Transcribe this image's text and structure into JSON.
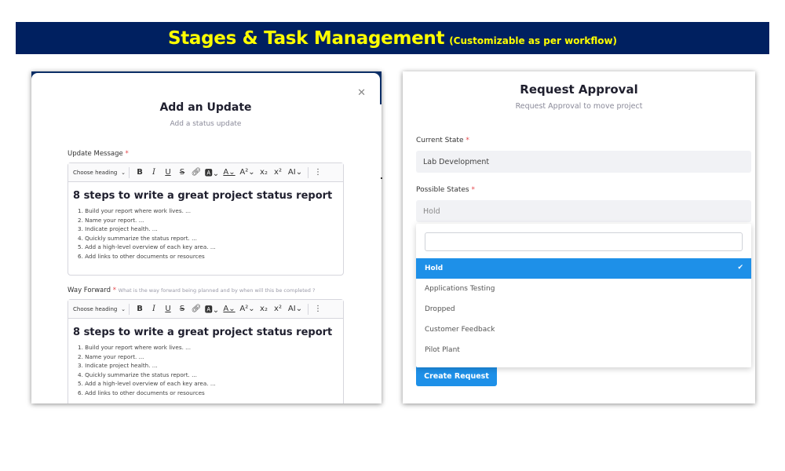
{
  "banner": {
    "title": "Stages & Task Management",
    "subtitle": "(Customizable as per workflow)",
    "bg_color": "#002060",
    "text_color": "#ffff00"
  },
  "update_modal": {
    "title": "Add an Update",
    "subtitle": "Add a status update",
    "close_icon": "close-icon",
    "update_message": {
      "label": "Update Message",
      "required_mark": "*",
      "heading_select": "Choose heading",
      "toolbar": [
        "B",
        "I",
        "U",
        "S",
        "🔗",
        "A",
        "A",
        "A²",
        "x₂",
        "x²",
        "A⫶",
        "⋮"
      ],
      "heading": "8 steps to write a great project status report",
      "items": [
        "1. Build your report where work lives. ...",
        "2. Name your report. ...",
        "3. Indicate project health. ...",
        "4. Quickly summarize the status report. ...",
        "5. Add a high-level overview of each key area. ...",
        "6. Add links to other documents or resources"
      ]
    },
    "way_forward": {
      "label": "Way Forward",
      "required_mark": "*",
      "hint": "What is the way forward being planned and by when will this be completed ?",
      "heading_select": "Choose heading",
      "heading": "8 steps to write a great project status report",
      "items": [
        "1. Build your report where work lives. ...",
        "2. Name your report. ...",
        "3. Indicate project health. ...",
        "4. Quickly summarize the status report. ...",
        "5. Add a high-level overview of each key area. ...",
        "6. Add links to other documents or resources"
      ]
    }
  },
  "approval": {
    "title": "Request Approval",
    "subtitle": "Request Approval to move project",
    "current_state_label": "Current State",
    "current_state_value": "Lab Development",
    "possible_states_label": "Possible States",
    "possible_states_value": "Hold",
    "required_mark": "*",
    "options": [
      "Hold",
      "Applications Testing",
      "Dropped",
      "Customer Feedback",
      "Pilot Plant"
    ],
    "selected_option": "Hold",
    "accent_color": "#1e90e8",
    "create_button": "Create Request"
  }
}
